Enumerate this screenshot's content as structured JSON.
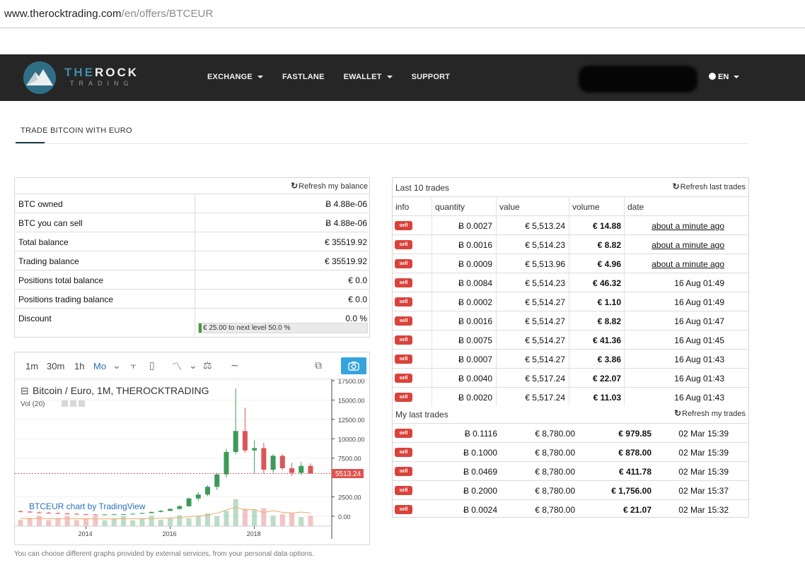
{
  "browser": {
    "url_host": "www.therocktrading.com",
    "url_path": "/en/offers/BTCEUR"
  },
  "nav": {
    "logo_the": "THE",
    "logo_rock": "ROCK",
    "logo_trading": "TRADING",
    "items": [
      "EXCHANGE",
      "FASTLANE",
      "EWALLET",
      "SUPPORT"
    ],
    "lang": "EN"
  },
  "tab": {
    "label": "TRADE BITCOIN WITH EURO"
  },
  "balance": {
    "refresh_label": "Refresh my balance",
    "rows": [
      {
        "label": "BTC owned",
        "value": "Ƀ 4.88e-06"
      },
      {
        "label": "BTC you can sell",
        "value": "Ƀ 4.88e-06"
      },
      {
        "label": "Total balance",
        "value": "€ 35519.92"
      },
      {
        "label": "Trading balance",
        "value": "€ 35519.92"
      },
      {
        "label": "Positions total balance",
        "value": "€ 0.0"
      },
      {
        "label": "Positions trading balance",
        "value": "€ 0.0"
      },
      {
        "label": "Discount",
        "value": "0.0 %"
      }
    ],
    "progress_text": "€ 25.00 to next level 50.0 %",
    "progress_fraction": 0.015
  },
  "chart_widget": {
    "timeframes": [
      "1m",
      "30m",
      "1h",
      "Mo"
    ],
    "active_timeframe": "Mo",
    "symbol_title": "Bitcoin / Euro, 1M, THEROCKTRADING",
    "indicator": "Vol (20)",
    "watermark": "BTCEUR chart by TradingView",
    "footer_note": "You can choose different graphs provided by external services, from your personal data options."
  },
  "chart_data": {
    "type": "bar",
    "title": "Bitcoin / Euro, 1M, THEROCKTRADING",
    "y_ticks": [
      "17500.00",
      "15000.00",
      "12500.00",
      "10000.00",
      "7500.00",
      "2500.00",
      "0.00"
    ],
    "x_ticks": [
      "2014",
      "2016",
      "2018"
    ],
    "last_price": "5513.24",
    "ylim": [
      0,
      17500
    ],
    "candles_monthly_approx": [
      {
        "o": 650,
        "h": 800,
        "l": 500,
        "c": 600
      },
      {
        "o": 600,
        "h": 700,
        "l": 450,
        "c": 500
      },
      {
        "o": 500,
        "h": 600,
        "l": 400,
        "c": 450
      },
      {
        "o": 450,
        "h": 550,
        "l": 350,
        "c": 400
      },
      {
        "o": 400,
        "h": 500,
        "l": 300,
        "c": 350
      },
      {
        "o": 350,
        "h": 450,
        "l": 280,
        "c": 320
      },
      {
        "o": 320,
        "h": 400,
        "l": 220,
        "c": 260
      },
      {
        "o": 260,
        "h": 320,
        "l": 180,
        "c": 220
      },
      {
        "o": 220,
        "h": 280,
        "l": 170,
        "c": 200
      },
      {
        "o": 200,
        "h": 260,
        "l": 170,
        "c": 230
      },
      {
        "o": 230,
        "h": 300,
        "l": 200,
        "c": 260
      },
      {
        "o": 260,
        "h": 320,
        "l": 220,
        "c": 280
      },
      {
        "o": 280,
        "h": 350,
        "l": 250,
        "c": 330
      },
      {
        "o": 330,
        "h": 450,
        "l": 300,
        "c": 420
      },
      {
        "o": 420,
        "h": 600,
        "l": 380,
        "c": 560
      },
      {
        "o": 560,
        "h": 800,
        "l": 500,
        "c": 700
      },
      {
        "o": 700,
        "h": 1000,
        "l": 650,
        "c": 950
      },
      {
        "o": 950,
        "h": 1400,
        "l": 850,
        "c": 1300
      },
      {
        "o": 1300,
        "h": 2400,
        "l": 1200,
        "c": 2300
      },
      {
        "o": 2300,
        "h": 3100,
        "l": 2000,
        "c": 2800
      },
      {
        "o": 2800,
        "h": 4000,
        "l": 2600,
        "c": 3800
      },
      {
        "o": 3800,
        "h": 5600,
        "l": 3400,
        "c": 5400
      },
      {
        "o": 5400,
        "h": 8700,
        "l": 5000,
        "c": 8300
      },
      {
        "o": 8300,
        "h": 16500,
        "l": 8000,
        "c": 11000
      },
      {
        "o": 11000,
        "h": 14000,
        "l": 8200,
        "c": 8500
      },
      {
        "o": 8500,
        "h": 9800,
        "l": 5500,
        "c": 8800
      },
      {
        "o": 8800,
        "h": 9500,
        "l": 5500,
        "c": 6000
      },
      {
        "o": 6000,
        "h": 8000,
        "l": 5600,
        "c": 7800
      },
      {
        "o": 7800,
        "h": 8000,
        "l": 6000,
        "c": 6200
      },
      {
        "o": 6200,
        "h": 6900,
        "l": 5200,
        "c": 5600
      },
      {
        "o": 5600,
        "h": 7000,
        "l": 5300,
        "c": 6500
      },
      {
        "o": 6500,
        "h": 6800,
        "l": 5500,
        "c": 5513
      }
    ]
  },
  "last_trades": {
    "title": "Last 10 trades",
    "refresh_label": "Refresh last trades",
    "headers": [
      "info",
      "quantity",
      "value",
      "volume",
      "date"
    ],
    "rows": [
      {
        "info": "sell",
        "quantity": "Ƀ 0.0027",
        "value": "€ 5,513.24",
        "volume": "€ 14.88",
        "date": "about a minute ago"
      },
      {
        "info": "sell",
        "quantity": "Ƀ 0.0016",
        "value": "€ 5,514.23",
        "volume": "€ 8.82",
        "date": "about a minute ago"
      },
      {
        "info": "sell",
        "quantity": "Ƀ 0.0009",
        "value": "€ 5,513.96",
        "volume": "€ 4.96",
        "date": "about a minute ago"
      },
      {
        "info": "sell",
        "quantity": "Ƀ 0.0084",
        "value": "€ 5,514.23",
        "volume": "€ 46.32",
        "date": "16 Aug 01:49"
      },
      {
        "info": "sell",
        "quantity": "Ƀ 0.0002",
        "value": "€ 5,514.27",
        "volume": "€ 1.10",
        "date": "16 Aug 01:49"
      },
      {
        "info": "sell",
        "quantity": "Ƀ 0.0016",
        "value": "€ 5,514.27",
        "volume": "€ 8.82",
        "date": "16 Aug 01:47"
      },
      {
        "info": "sell",
        "quantity": "Ƀ 0.0075",
        "value": "€ 5,514.27",
        "volume": "€ 41.36",
        "date": "16 Aug 01:45"
      },
      {
        "info": "sell",
        "quantity": "Ƀ 0.0007",
        "value": "€ 5,514.27",
        "volume": "€ 3.86",
        "date": "16 Aug 01:43"
      },
      {
        "info": "sell",
        "quantity": "Ƀ 0.0040",
        "value": "€ 5,517.24",
        "volume": "€ 22.07",
        "date": "16 Aug 01:43"
      },
      {
        "info": "sell",
        "quantity": "Ƀ 0.0020",
        "value": "€ 5,517.24",
        "volume": "€ 11.03",
        "date": "16 Aug 01:43"
      }
    ]
  },
  "my_trades": {
    "title": "My last trades",
    "refresh_label": "Refresh my trades",
    "rows": [
      {
        "info": "sell",
        "quantity": "Ƀ 0.1116",
        "value": "€ 8,780.00",
        "volume": "€ 979.85",
        "date": "02 Mar 15:39"
      },
      {
        "info": "sell",
        "quantity": "Ƀ 0.1000",
        "value": "€ 8,780.00",
        "volume": "€ 878.00",
        "date": "02 Mar 15:39"
      },
      {
        "info": "sell",
        "quantity": "Ƀ 0.0469",
        "value": "€ 8,780.00",
        "volume": "€ 411.78",
        "date": "02 Mar 15:39"
      },
      {
        "info": "sell",
        "quantity": "Ƀ 0.2000",
        "value": "€ 8,780.00",
        "volume": "€ 1,756.00",
        "date": "02 Mar 15:37"
      },
      {
        "info": "sell",
        "quantity": "Ƀ 0.0024",
        "value": "€ 8,780.00",
        "volume": "€ 21.07",
        "date": "02 Mar 15:32"
      }
    ]
  },
  "colors": {
    "nav_bg": "#262626",
    "sell_badge": "#d9433c",
    "candle_up": "#3d9a5a",
    "candle_down": "#d95757",
    "tv_blue": "#2a72b8"
  }
}
